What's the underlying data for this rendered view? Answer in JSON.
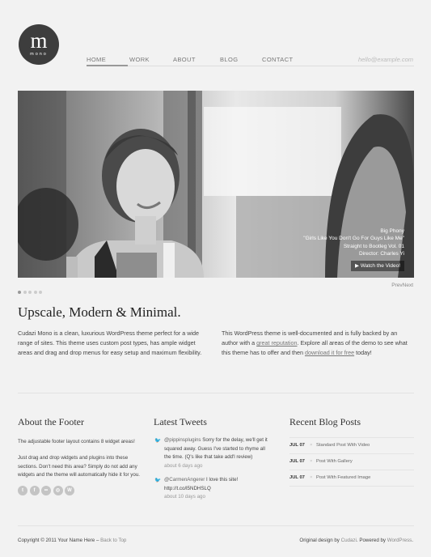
{
  "logo": {
    "letter": "m",
    "sub": "mono"
  },
  "nav": {
    "items": [
      "HOME",
      "WORK",
      "ABOUT",
      "BLOG",
      "CONTACT"
    ],
    "email": "hello@example.com"
  },
  "slider": {
    "caption": [
      "Big Phony",
      "\"Girls Like You Don't Go For Guys Like Me\"",
      "Straight to Bootleg Vol. 01",
      "Director: Charles Yi"
    ],
    "watch": "Watch the Video!",
    "prevnext": "PrevNext",
    "slide_count": 5,
    "active_slide": 1
  },
  "intro": {
    "title": "Upscale, Modern & Minimal.",
    "left": "Cudazi Mono is a clean, luxurious WordPress theme perfect for a wide range of sites. This theme uses custom post types, has ample widget areas and drag and drop menus for easy setup and maximum flexibility.",
    "right_1": "This WordPress theme is well-documented and is fully backed by an author with a",
    "right_link1": "great reputation",
    "right_2": ". Explore all areas of the demo to see what this theme has to offer and then",
    "right_link2": "download it for free",
    "right_3": " today!"
  },
  "footer_about": {
    "title": "About the Footer",
    "p1": "The adjustable footer layout contains 8 widget areas!",
    "p2": "Just drag and drop widgets and plugins into these sections. Don't need this area? Simply do not add any widgets and the theme will automatically hide it for you."
  },
  "tweets": {
    "title": "Latest Tweets",
    "items": [
      {
        "handle": "@pippinsplugins",
        "text": " Sorry for the delay, we'll get it squared away. Guess I've started to rhyme all the time. (Q's like that take add'l review)",
        "ago": "about 6 days ago"
      },
      {
        "handle": "@CarmenAngerer",
        "text": " I love this site! http://t.co/l5NDHSLQ",
        "ago": "about 10 days ago"
      }
    ]
  },
  "blog": {
    "title": "Recent Blog Posts",
    "items": [
      {
        "date": "JUL 07",
        "title": "Standard Post With Video"
      },
      {
        "date": "JUL 07",
        "title": "Post With Gallery"
      },
      {
        "date": "JUL 07",
        "title": "Post With Featured Image"
      }
    ]
  },
  "bottom": {
    "copyright": "Copyright © 2011 Your Name Here –",
    "back_to_top": "Back to Top",
    "credit_pre": "Original design by",
    "cudazi": "Cudazi",
    "credit_mid": ". Powered by",
    "wordpress": "WordPress",
    "credit_end": "."
  }
}
